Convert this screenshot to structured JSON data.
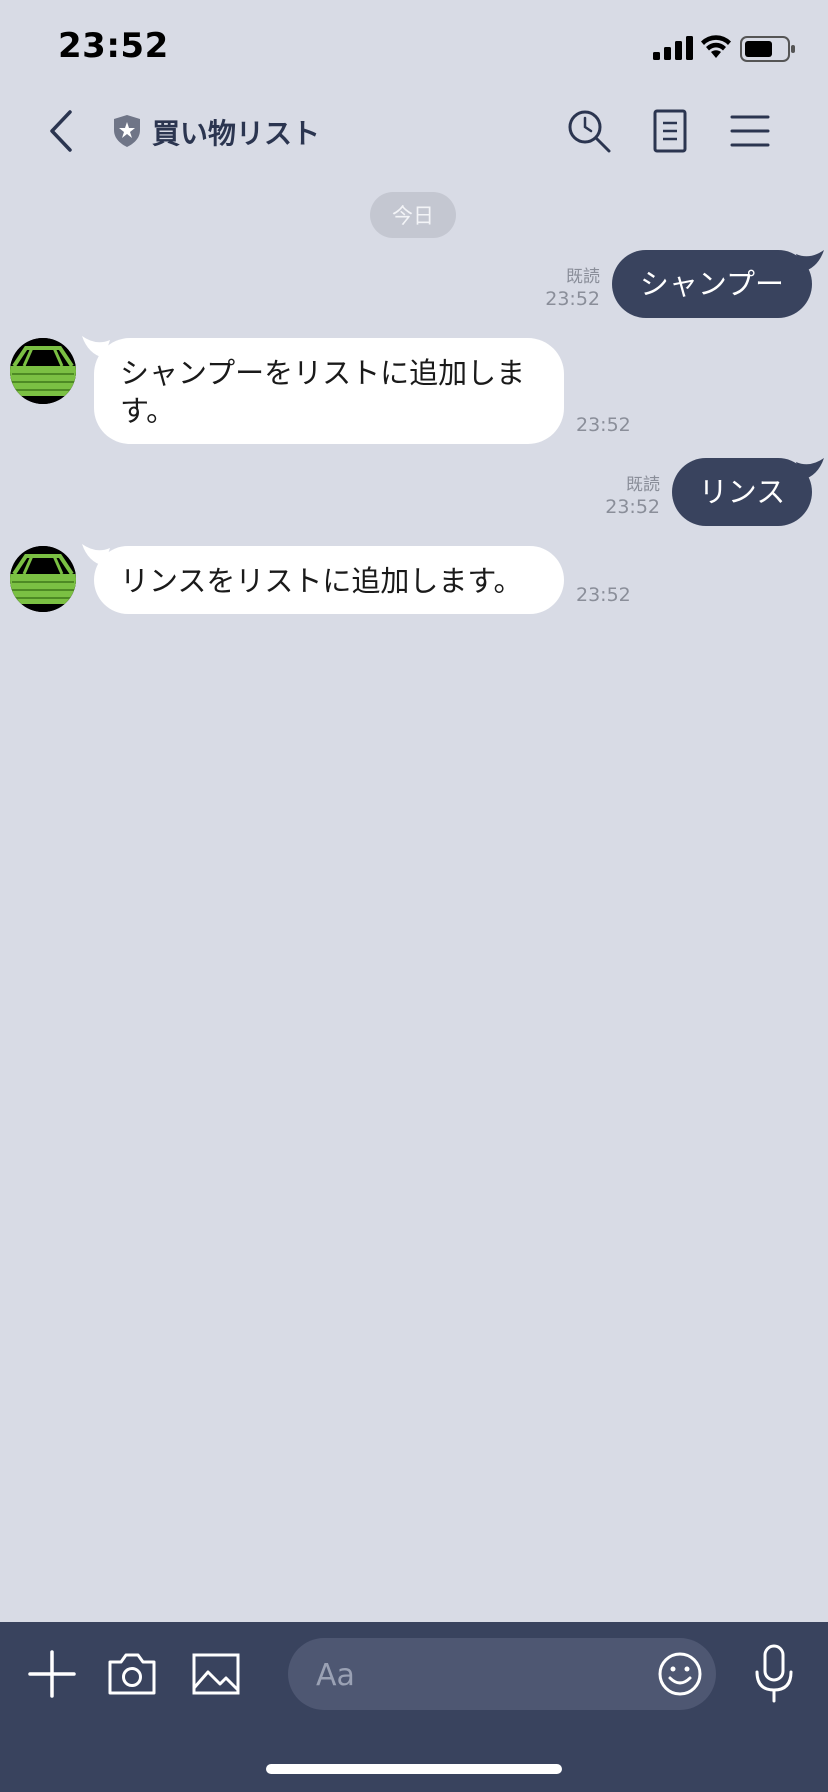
{
  "status_bar": {
    "time": "23:52"
  },
  "header": {
    "title": "買い物リスト"
  },
  "date_separator": "今日",
  "messages": [
    {
      "direction": "out",
      "text": "シャンプー",
      "read_label": "既読",
      "time": "23:52"
    },
    {
      "direction": "in",
      "text": "シャンプーをリストに追加します。",
      "time": "23:52"
    },
    {
      "direction": "out",
      "text": "リンス",
      "read_label": "既読",
      "time": "23:52"
    },
    {
      "direction": "in",
      "text": "リンスをリストに追加します。",
      "time": "23:52"
    }
  ],
  "input": {
    "placeholder": "Aa",
    "value": ""
  },
  "colors": {
    "background": "#d8dbe5",
    "outgoing_bubble": "#39435e",
    "incoming_bubble": "#ffffff",
    "bottom_bar": "#39435e",
    "avatar_green": "#7bc043"
  },
  "icons": [
    "back-icon",
    "shield-star-icon",
    "search-clock-icon",
    "note-icon",
    "menu-icon",
    "plus-icon",
    "camera-icon",
    "image-icon",
    "emoji-icon",
    "mic-icon"
  ]
}
